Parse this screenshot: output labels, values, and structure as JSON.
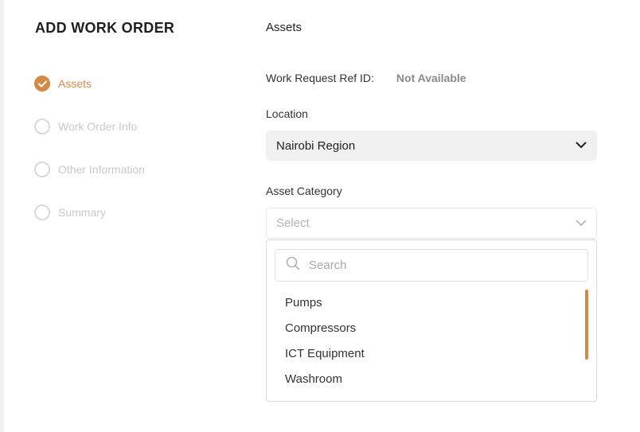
{
  "page": {
    "title": "ADD WORK ORDER"
  },
  "steps": [
    {
      "label": "Assets",
      "state": "done"
    },
    {
      "label": "Work Order Info",
      "state": "pending"
    },
    {
      "label": "Other Information",
      "state": "pending"
    },
    {
      "label": "Summary",
      "state": "pending"
    }
  ],
  "form": {
    "section_title": "Assets",
    "ref": {
      "label": "Work Request Ref ID:",
      "value": "Not Available"
    },
    "location": {
      "label": "Location",
      "value": "Nairobi Region"
    },
    "asset_category": {
      "label": "Asset Category",
      "placeholder": "Select",
      "search_placeholder": "Search",
      "options": [
        "Pumps",
        "Compressors",
        "ICT Equipment",
        "Washroom"
      ]
    }
  },
  "colors": {
    "accent": "#d48a45",
    "muted": "#c9c9c9",
    "field_bg": "#f1f0f0"
  },
  "icons": {
    "check": "check-icon",
    "chevron": "chevron-down-icon",
    "search": "search-icon"
  }
}
